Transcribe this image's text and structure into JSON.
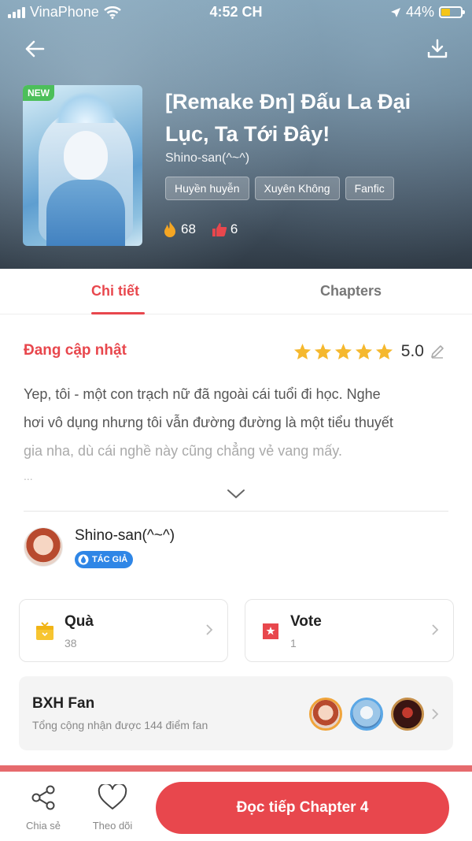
{
  "status_bar": {
    "carrier": "VinaPhone",
    "time": "4:52 CH",
    "battery": "44%",
    "battery_level": 0.44
  },
  "story": {
    "badge": "NEW",
    "title": "[Remake Đn] Đấu La Đại Lục, Ta Tới Đây!",
    "author": "Shino-san(^~^)",
    "tags": [
      "Huyền huyễn",
      "Xuyên Không",
      "Fanfic"
    ],
    "fire_count": "68",
    "like_count": "6"
  },
  "tabs": {
    "detail": "Chi tiết",
    "chapters": "Chapters"
  },
  "detail": {
    "status": "Đang cập nhật",
    "rating_stars": 5,
    "rating_score": "5.0",
    "description_line1": "Yep, tôi - một con trạch nữ đã ngoài cái tuổi đi học. Nghe",
    "description_line2": "hơi vô dụng nhưng tôi vẫn đường đường là một tiểu thuyết",
    "description_line3": "gia nha, dù cái nghề này cũng chẳng vẻ vang mấy.",
    "ellipsis": "..."
  },
  "author_section": {
    "name": "Shino-san(^~^)",
    "badge": "TÁC GIẢ"
  },
  "cards": {
    "gift": {
      "title": "Quà",
      "count": "38"
    },
    "vote": {
      "title": "Vote",
      "count": "1"
    }
  },
  "fan_ranking": {
    "title": "BXH Fan",
    "subtitle": "Tổng cộng nhận được 144 điểm fan"
  },
  "bottom_bar": {
    "share": "Chia sẻ",
    "follow": "Theo dõi",
    "continue": "Đọc tiếp Chapter 4"
  },
  "colors": {
    "accent": "#e8474d",
    "author_badge": "#2f86e6",
    "star": "#f5b82e",
    "new_badge": "#4cbf5a"
  },
  "icons": [
    "back-arrow-icon",
    "download-icon",
    "fire-icon",
    "thumbs-up-icon",
    "edit-icon",
    "chevron-down-icon",
    "gift-icon",
    "vote-icon",
    "chevron-right-icon",
    "share-icon",
    "heart-icon",
    "wifi-icon",
    "location-icon",
    "battery-icon",
    "signal-icon"
  ]
}
